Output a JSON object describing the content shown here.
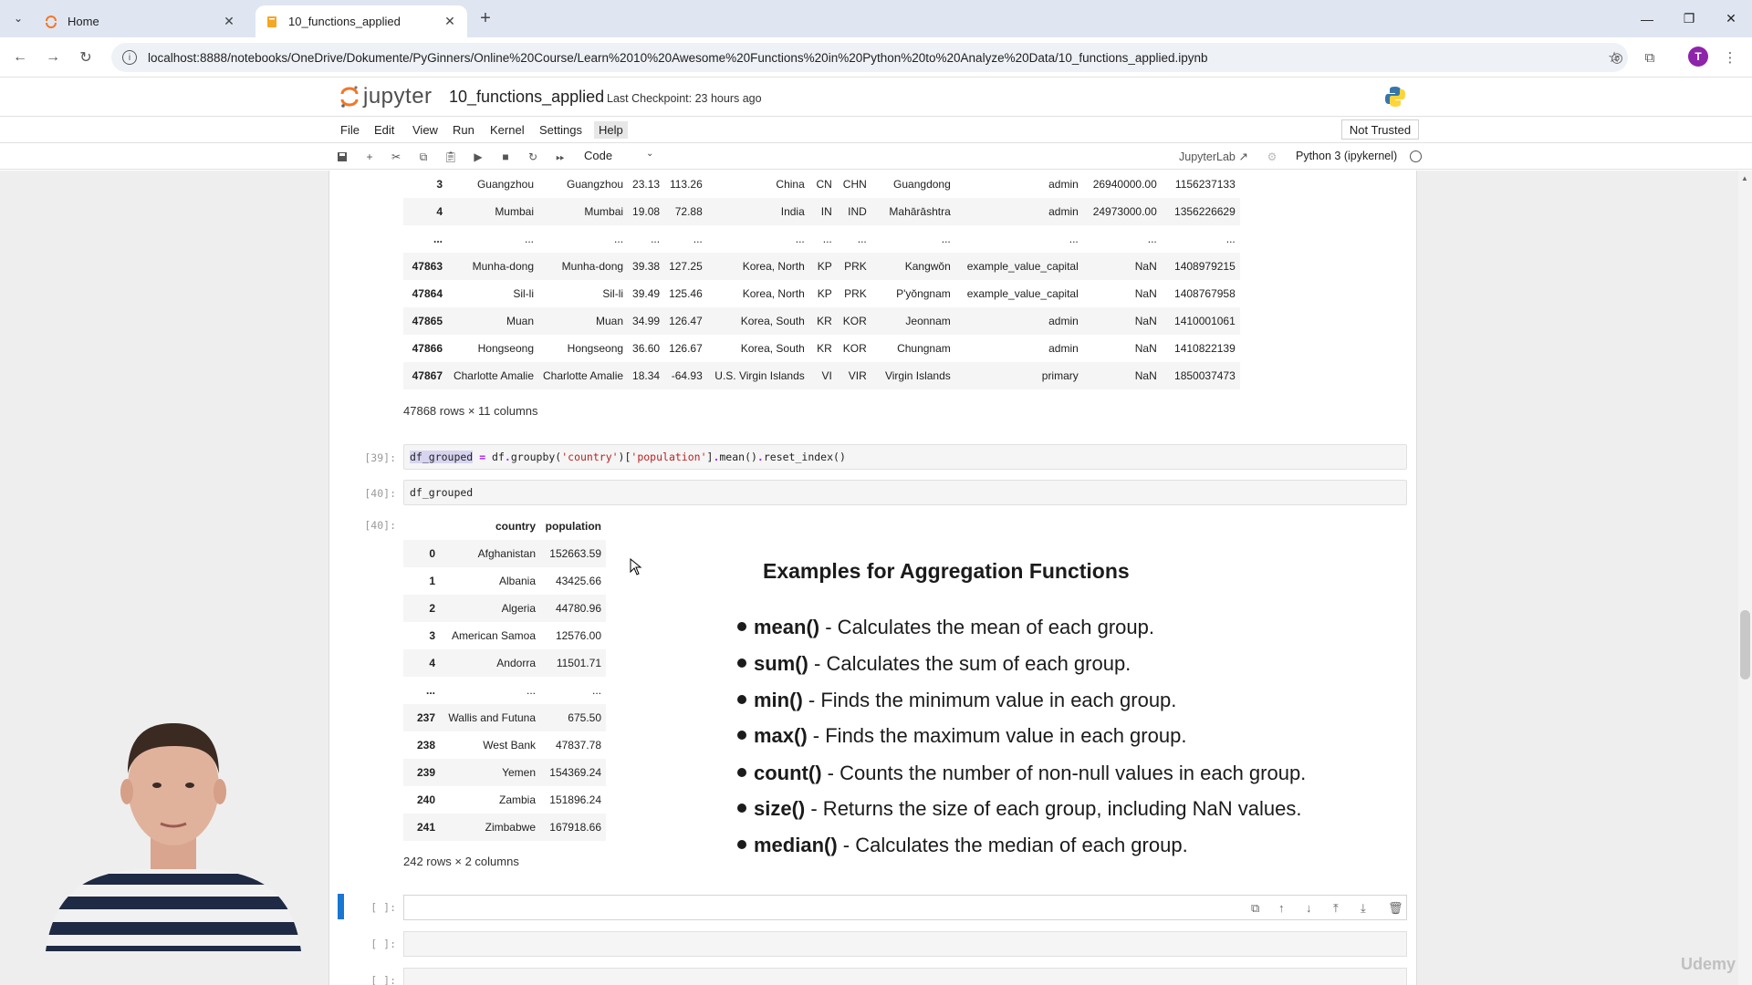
{
  "browser": {
    "tabs": [
      {
        "title": "Home",
        "active": false
      },
      {
        "title": "10_functions_applied",
        "active": true
      }
    ],
    "url": "localhost:8888/notebooks/OneDrive/Dokumente/PyGinners/Online%20Course/Learn%2010%20Awesome%20Functions%20in%20Python%20to%20Analyze%20Data/10_functions_applied.ipynb",
    "profile_initial": "T"
  },
  "jupyter": {
    "logo_text": "jupyter",
    "notebook_name": "10_functions_applied",
    "checkpoint": "Last Checkpoint: 23 hours ago",
    "menu": [
      "File",
      "Edit",
      "View",
      "Run",
      "Kernel",
      "Settings",
      "Help"
    ],
    "trust_label": "Not Trusted",
    "cell_type": "Code",
    "jupyterlab_label": "JupyterLab",
    "kernel_label": "Python 3 (ipykernel)"
  },
  "big_df": {
    "rows": [
      [
        "3",
        "Guangzhou",
        "Guangzhou",
        "23.13",
        "113.26",
        "China",
        "CN",
        "CHN",
        "Guangdong",
        "admin",
        "26940000.00",
        "1156237133"
      ],
      [
        "4",
        "Mumbai",
        "Mumbai",
        "19.08",
        "72.88",
        "India",
        "IN",
        "IND",
        "Mahārāshtra",
        "admin",
        "24973000.00",
        "1356226629"
      ],
      [
        "...",
        "...",
        "...",
        "...",
        "...",
        "...",
        "...",
        "...",
        "...",
        "...",
        "...",
        "..."
      ],
      [
        "47863",
        "Munha-dong",
        "Munha-dong",
        "39.38",
        "127.25",
        "Korea, North",
        "KP",
        "PRK",
        "Kangwŏn",
        "example_value_capital",
        "NaN",
        "1408979215"
      ],
      [
        "47864",
        "Sil-li",
        "Sil-li",
        "39.49",
        "125.46",
        "Korea, North",
        "KP",
        "PRK",
        "P'yŏngnam",
        "example_value_capital",
        "NaN",
        "1408767958"
      ],
      [
        "47865",
        "Muan",
        "Muan",
        "34.99",
        "126.47",
        "Korea, South",
        "KR",
        "KOR",
        "Jeonnam",
        "admin",
        "NaN",
        "1410001061"
      ],
      [
        "47866",
        "Hongseong",
        "Hongseong",
        "36.60",
        "126.67",
        "Korea, South",
        "KR",
        "KOR",
        "Chungnam",
        "admin",
        "NaN",
        "1410822139"
      ],
      [
        "47867",
        "Charlotte Amalie",
        "Charlotte Amalie",
        "18.34",
        "-64.93",
        "U.S. Virgin Islands",
        "VI",
        "VIR",
        "Virgin Islands",
        "primary",
        "NaN",
        "1850037473"
      ]
    ],
    "shape": "47868 rows × 11 columns"
  },
  "cells": {
    "c39": {
      "prompt": "[39]:"
    },
    "c40": {
      "prompt": "[40]:",
      "code": "df_grouped"
    },
    "out40": {
      "prompt": "[40]:"
    },
    "e1": {
      "prompt": "[ ]:"
    },
    "e2": {
      "prompt": "[ ]:"
    },
    "e3": {
      "prompt": "[ ]:"
    }
  },
  "code39": {
    "t1": "df_grouped",
    "t2": " ",
    "t3": "=",
    "t4": " df",
    "t5": ".",
    "t6": "groupby(",
    "t7": "'country'",
    "t8": ")[",
    "t9": "'population'",
    "t10": "]",
    "t11": ".",
    "t12": "mean()",
    "t13": ".",
    "t14": "reset_index()"
  },
  "small_df": {
    "columns": [
      "country",
      "population"
    ],
    "rows": [
      [
        "0",
        "Afghanistan",
        "152663.59"
      ],
      [
        "1",
        "Albania",
        "43425.66"
      ],
      [
        "2",
        "Algeria",
        "44780.96"
      ],
      [
        "3",
        "American Samoa",
        "12576.00"
      ],
      [
        "4",
        "Andorra",
        "11501.71"
      ],
      [
        "...",
        "...",
        "..."
      ],
      [
        "237",
        "Wallis and Futuna",
        "675.50"
      ],
      [
        "238",
        "West Bank",
        "47837.78"
      ],
      [
        "239",
        "Yemen",
        "154369.24"
      ],
      [
        "240",
        "Zambia",
        "151896.24"
      ],
      [
        "241",
        "Zimbabwe",
        "167918.66"
      ]
    ],
    "shape": "242 rows × 2 columns"
  },
  "slide": {
    "title": "Examples for Aggregation Functions",
    "bullets": [
      {
        "fn": "mean()",
        "desc": " - Calculates the mean of each group."
      },
      {
        "fn": "sum()",
        "desc": " - Calculates the sum of each group."
      },
      {
        "fn": "min()",
        "desc": " - Finds the minimum value in each group."
      },
      {
        "fn": "max()",
        "desc": " - Finds the maximum value in each group."
      },
      {
        "fn": "count()",
        "desc": " - Counts the number of non-null values in each group."
      },
      {
        "fn": "size()",
        "desc": " - Returns the size of each group, including NaN values."
      },
      {
        "fn": "median()",
        "desc": " - Calculates the median of each group."
      }
    ]
  },
  "watermark": "Udemy"
}
